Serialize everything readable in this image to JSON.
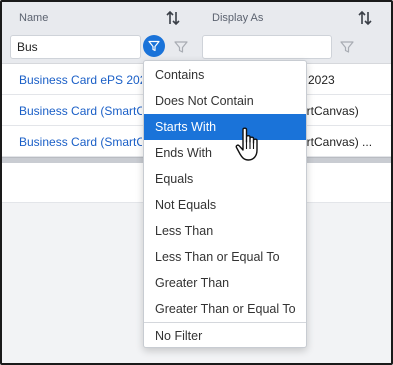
{
  "columns": {
    "name": {
      "title": "Name",
      "filter_value": "Bus"
    },
    "display_as": {
      "title": "Display As",
      "filter_value": ""
    }
  },
  "rows": [
    {
      "name": "Business Card ePS 2023",
      "display_as": "2023"
    },
    {
      "name": "Business Card (SmartCanvas)",
      "display_as": "artCanvas)"
    },
    {
      "name": "Business Card (SmartCanvas)",
      "display_as": "artCanvas) ..."
    }
  ],
  "filter_menu": {
    "items": [
      "Contains",
      "Does Not Contain",
      "Starts With",
      "Ends With",
      "Equals",
      "Not Equals",
      "Less Than",
      "Less Than or Equal To",
      "Greater Than",
      "Greater Than or Equal To"
    ],
    "selected": "Starts With",
    "no_filter": "No Filter"
  },
  "colors": {
    "accent": "#1a73d9",
    "link": "#1a5fc7",
    "header_bg": "#e8eaee"
  },
  "icons": {
    "sort": "sort-arrows-icon",
    "filter_active": "filter-icon",
    "filter_idle": "filter-outline-icon",
    "cursor": "hand-pointer-icon"
  }
}
